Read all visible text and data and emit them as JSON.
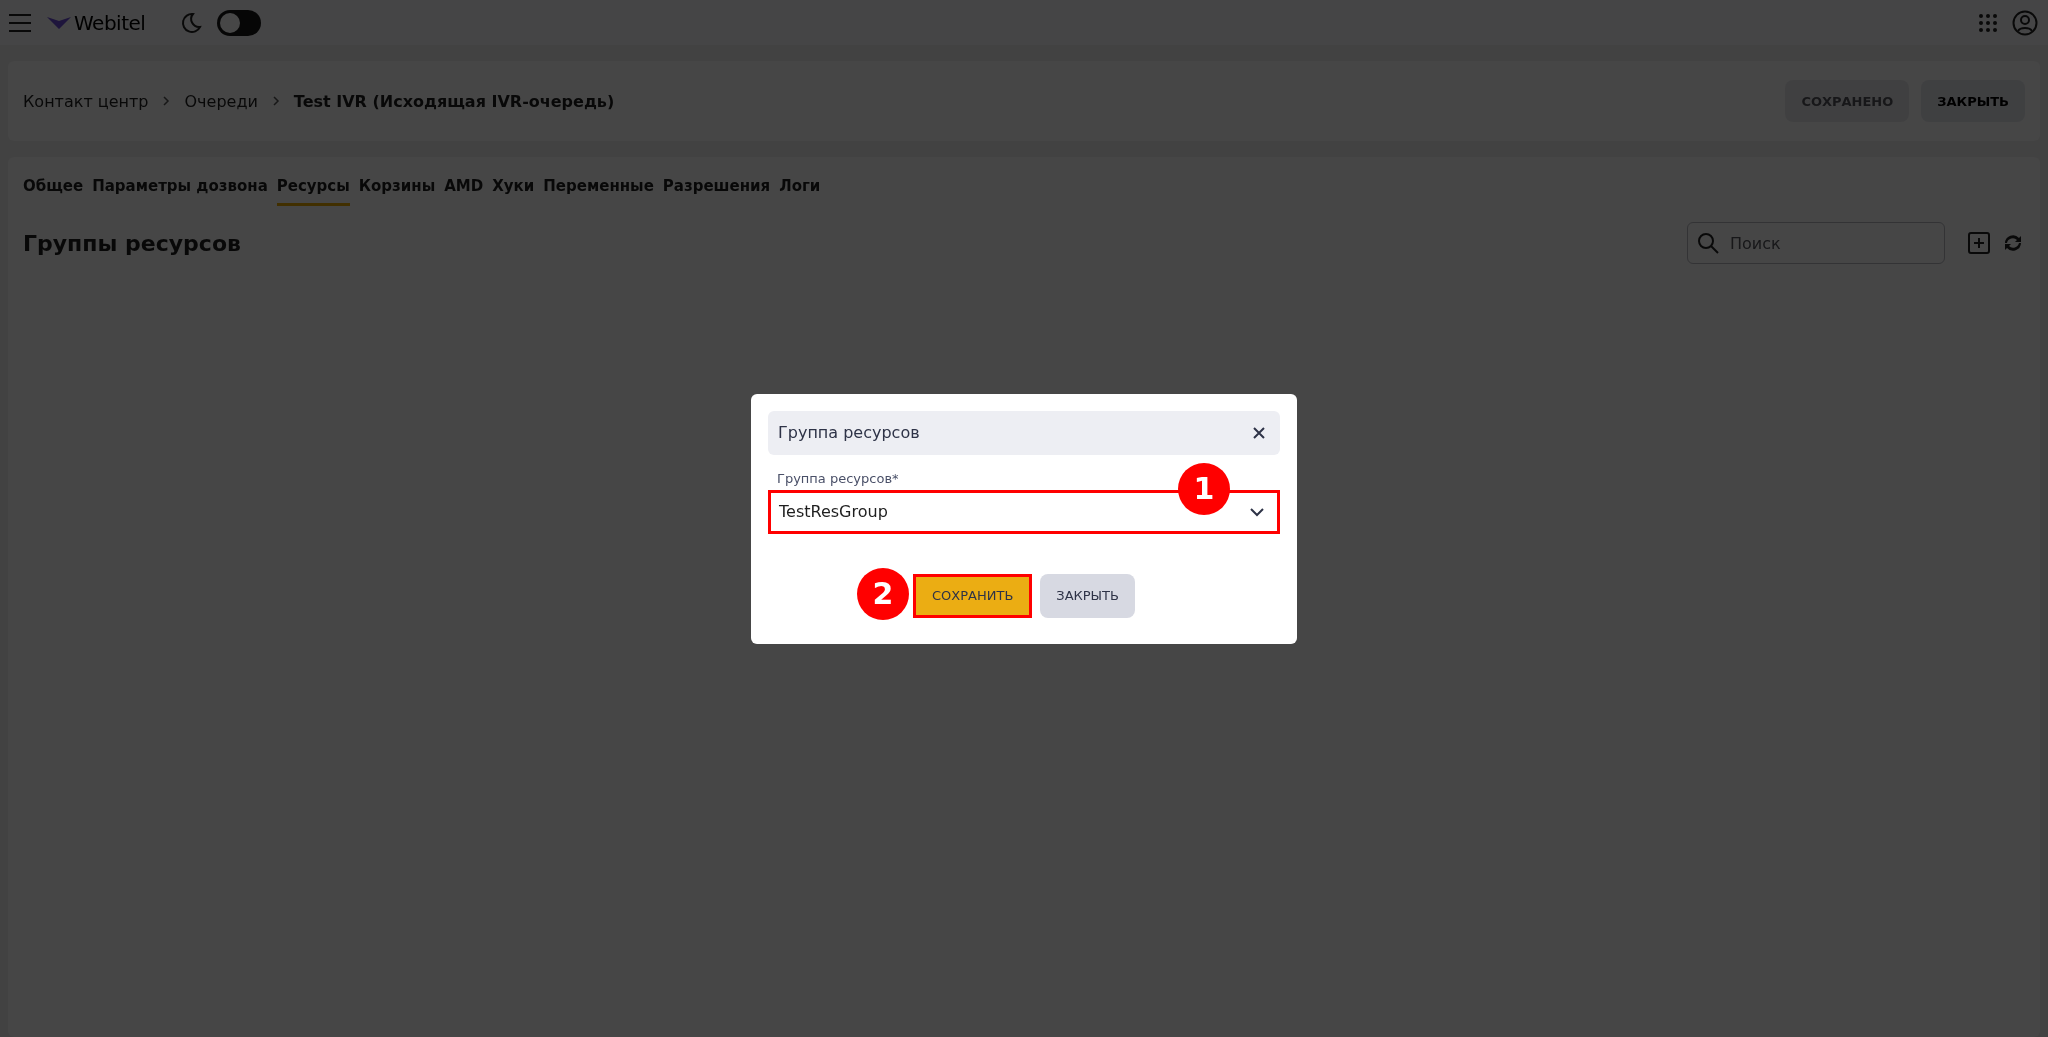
{
  "top_bar": {
    "logo": "Webitel",
    "theme_toggle": {
      "on": false
    }
  },
  "breadcrumbs": [
    {
      "label": "Контакт центр",
      "current": false
    },
    {
      "label": "Очереди",
      "current": false
    },
    {
      "label": "Test IVR (Исходящая IVR-очередь)",
      "current": true
    }
  ],
  "header_buttons": [
    {
      "label": "СОХРАНЕНО",
      "disabled": true
    },
    {
      "label": "ЗАКРЫТЬ",
      "disabled": false
    }
  ],
  "tabs": [
    {
      "label": "Общее",
      "selected": false
    },
    {
      "label": "Параметры дозвона",
      "selected": false
    },
    {
      "label": "Ресурсы",
      "selected": true
    },
    {
      "label": "Корзины",
      "selected": false
    },
    {
      "label": "AMD",
      "selected": false
    },
    {
      "label": "Хуки",
      "selected": false
    },
    {
      "label": "Переменные",
      "selected": false
    },
    {
      "label": "Разрешения",
      "selected": false
    },
    {
      "label": "Логи",
      "selected": false
    }
  ],
  "section": {
    "title": "Группы ресурсов",
    "search": {
      "placeholder": "Поиск"
    }
  },
  "dialog": {
    "title": "Группа ресурсов",
    "field": {
      "label": "Группа ресурсов*",
      "value": "TestResGroup",
      "highlighted": true,
      "marker": "1"
    },
    "buttons": [
      {
        "label": "СОХРАНИТЬ",
        "kind": "primary",
        "highlighted": true,
        "marker": "2"
      },
      {
        "label": "ЗАКРЫТЬ",
        "kind": "secondary",
        "highlighted": false
      }
    ]
  }
}
